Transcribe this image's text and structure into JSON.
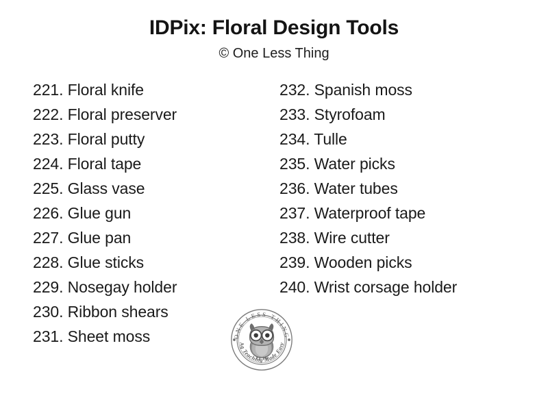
{
  "document": {
    "title": "IDPix: Floral Design Tools",
    "subtitle": "© One Less Thing",
    "background_color": "#ffffff",
    "text_color": "#1a1a1a"
  },
  "columns": {
    "left": [
      {
        "number": "221.",
        "label": "Floral knife"
      },
      {
        "number": "222.",
        "label": "Floral preserver"
      },
      {
        "number": "223.",
        "label": "Floral putty"
      },
      {
        "number": "224.",
        "label": "Floral tape"
      },
      {
        "number": "225.",
        "label": "Glass vase"
      },
      {
        "number": "226.",
        "label": "Glue gun"
      },
      {
        "number": "227.",
        "label": "Glue pan"
      },
      {
        "number": "228.",
        "label": "Glue sticks"
      },
      {
        "number": "229.",
        "label": "Nosegay holder"
      },
      {
        "number": "230.",
        "label": "Ribbon shears"
      },
      {
        "number": "231.",
        "label": "Sheet moss"
      }
    ],
    "right": [
      {
        "number": "232.",
        "label": "Spanish moss"
      },
      {
        "number": "233.",
        "label": "Styrofoam"
      },
      {
        "number": "234.",
        "label": "Tulle"
      },
      {
        "number": "235.",
        "label": "Water picks"
      },
      {
        "number": "236.",
        "label": "Water tubes"
      },
      {
        "number": "237.",
        "label": "Waterproof tape"
      },
      {
        "number": "238.",
        "label": "Wire cutter"
      },
      {
        "number": "239.",
        "label": "Wooden picks"
      },
      {
        "number": "240.",
        "label": "Wrist corsage holder"
      }
    ]
  },
  "logo": {
    "top_arc_text": "ONE LESS THING",
    "bottom_arc_text": "Ag Teaching Made Easy",
    "emblem": "owl",
    "ring_color": "#6e6e6e",
    "fill_color": "#9a9a9a"
  }
}
